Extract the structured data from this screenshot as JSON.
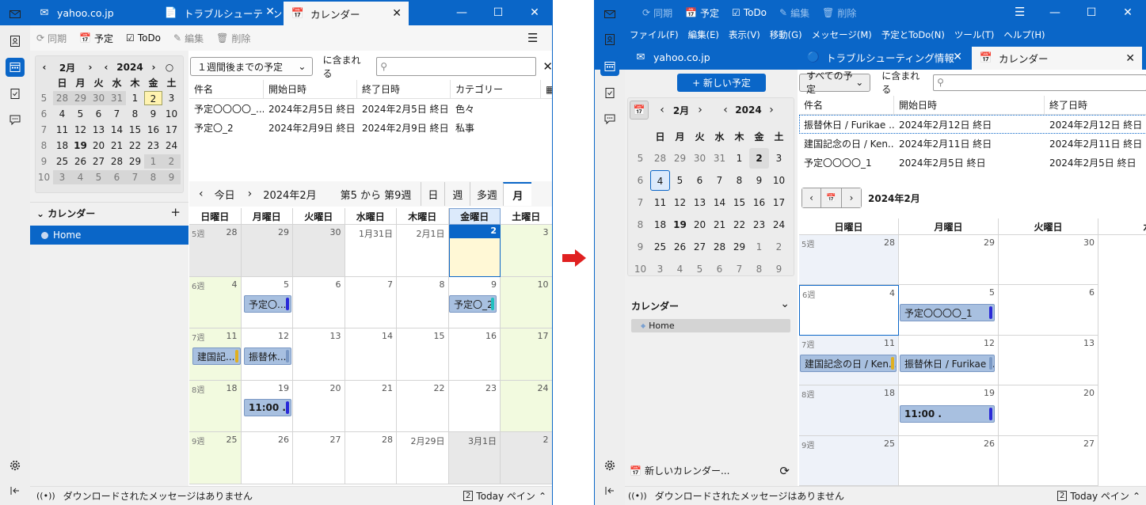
{
  "left": {
    "tabs": [
      {
        "icon": "mail-icon",
        "label": "yahoo.co.jp"
      },
      {
        "icon": "article-icon",
        "label": "トラブルシューティング"
      },
      {
        "icon": "calendar-icon",
        "label": "カレンダー"
      }
    ],
    "toolbar": {
      "sync": "同期",
      "event": "予定",
      "todo": "ToDo",
      "edit": "編集",
      "delete": "削除"
    },
    "minimonth": {
      "month": "2月",
      "year": "2024",
      "weekdays": [
        "日",
        "月",
        "火",
        "水",
        "木",
        "金",
        "土"
      ],
      "weeks": [
        {
          "wk": "5",
          "days": [
            "28",
            "29",
            "30",
            "31",
            "1",
            "2",
            "3"
          ]
        },
        {
          "wk": "6",
          "days": [
            "4",
            "5",
            "6",
            "7",
            "8",
            "9",
            "10"
          ]
        },
        {
          "wk": "7",
          "days": [
            "11",
            "12",
            "13",
            "14",
            "15",
            "16",
            "17"
          ]
        },
        {
          "wk": "8",
          "days": [
            "18",
            "19",
            "20",
            "21",
            "22",
            "23",
            "24"
          ]
        },
        {
          "wk": "9",
          "days": [
            "25",
            "26",
            "27",
            "28",
            "29",
            "1",
            "2"
          ]
        },
        {
          "wk": "10",
          "days": [
            "3",
            "4",
            "5",
            "6",
            "7",
            "8",
            "9"
          ]
        }
      ]
    },
    "calendars": {
      "title": "カレンダー",
      "add": "+",
      "items": [
        "Home"
      ]
    },
    "filter": {
      "range": "１週間後までの予定",
      "contains": "に含まれる",
      "search_placeholder": ""
    },
    "unifinder": {
      "headers": [
        "件名",
        "開始日時",
        "終了日時",
        "カテゴリー"
      ],
      "rows": [
        [
          "予定〇〇〇〇_...",
          "2024年2月5日 終日",
          "2024年2月5日 終日",
          "色々"
        ],
        [
          "予定〇_2",
          "2024年2月9日 終日",
          "2024年2月9日 終日",
          "私事"
        ]
      ]
    },
    "nav": {
      "today": "今日",
      "title": "2024年2月",
      "weeks": "第5 から 第9週",
      "views": [
        "日",
        "週",
        "多週",
        "月"
      ]
    },
    "weekdays": [
      "日曜日",
      "月曜日",
      "火曜日",
      "水曜日",
      "木曜日",
      "金曜日",
      "土曜日"
    ],
    "rows": [
      {
        "wk": "5週",
        "days": [
          "28",
          "29",
          "30",
          "1月31日",
          "2月1日",
          "2",
          "3"
        ]
      },
      {
        "wk": "6週",
        "days": [
          "4",
          "5",
          "6",
          "7",
          "8",
          "9",
          "10"
        ]
      },
      {
        "wk": "7週",
        "days": [
          "11",
          "12",
          "13",
          "14",
          "15",
          "16",
          "17"
        ]
      },
      {
        "wk": "8週",
        "days": [
          "18",
          "19",
          "20",
          "21",
          "22",
          "23",
          "24"
        ]
      },
      {
        "wk": "9週",
        "days": [
          "25",
          "26",
          "27",
          "28",
          "2月29日",
          "3月1日",
          "2"
        ]
      }
    ],
    "events": {
      "e1": "予定〇...",
      "e2": "予定〇_2",
      "e3": "建国記...",
      "e4": "振替休...",
      "e5": "11:00 ."
    },
    "status": {
      "text": "ダウンロードされたメッセージはありません",
      "today_pane": "Today ペイン",
      "today_num": "2"
    }
  },
  "right": {
    "toolbar": {
      "sync": "同期",
      "event": "予定",
      "todo": "ToDo",
      "edit": "編集",
      "delete": "削除"
    },
    "menu": [
      "ファイル(F)",
      "編集(E)",
      "表示(V)",
      "移動(G)",
      "メッセージ(M)",
      "予定とToDo(N)",
      "ツール(T)",
      "ヘルプ(H)"
    ],
    "tabs": [
      {
        "icon": "mail-icon",
        "label": "yahoo.co.jp"
      },
      {
        "icon": "article-icon",
        "label": "トラブルシューティング情報"
      },
      {
        "icon": "calendar-icon",
        "label": "カレンダー"
      }
    ],
    "new_event": "+ 新しい予定",
    "minimonth": {
      "month": "2月",
      "year": "2024",
      "weekdays": [
        "日",
        "月",
        "火",
        "水",
        "木",
        "金",
        "土"
      ],
      "weeks": [
        {
          "wk": "5",
          "days": [
            "28",
            "29",
            "30",
            "31",
            "1",
            "2",
            "3"
          ]
        },
        {
          "wk": "6",
          "days": [
            "4",
            "5",
            "6",
            "7",
            "8",
            "9",
            "10"
          ]
        },
        {
          "wk": "7",
          "days": [
            "11",
            "12",
            "13",
            "14",
            "15",
            "16",
            "17"
          ]
        },
        {
          "wk": "8",
          "days": [
            "18",
            "19",
            "20",
            "21",
            "22",
            "23",
            "24"
          ]
        },
        {
          "wk": "9",
          "days": [
            "25",
            "26",
            "27",
            "28",
            "29",
            "1",
            "2"
          ]
        },
        {
          "wk": "10",
          "days": [
            "3",
            "4",
            "5",
            "6",
            "7",
            "8",
            "9"
          ]
        }
      ]
    },
    "calendars": {
      "title": "カレンダー",
      "items": [
        "Home"
      ],
      "new_calendar": "新しいカレンダー..."
    },
    "filter": {
      "range": "すべての予定",
      "contains": "に含まれる"
    },
    "unifinder": {
      "headers": [
        "件名",
        "開始日時",
        "終了日時"
      ],
      "rows": [
        [
          "振替休日 / Furikae ...",
          "2024年2月12日 終日",
          "2024年2月12日 終日"
        ],
        [
          "建国記念の日 / Ken...",
          "2024年2月11日 終日",
          "2024年2月11日 終日"
        ],
        [
          "予定〇〇〇〇_1",
          "2024年2月5日 終日",
          "2024年2月5日 終日"
        ]
      ]
    },
    "nav": {
      "title": "2024年2月"
    },
    "weekdays": [
      "日曜日",
      "月曜日",
      "火曜日",
      "水"
    ],
    "rows": [
      {
        "wk": "5週",
        "days": [
          "28",
          "29",
          "30"
        ]
      },
      {
        "wk": "6週",
        "days": [
          "4",
          "5",
          "6"
        ]
      },
      {
        "wk": "7週",
        "days": [
          "11",
          "12",
          "13"
        ]
      },
      {
        "wk": "8週",
        "days": [
          "18",
          "19",
          "20"
        ]
      },
      {
        "wk": "9週",
        "days": [
          "25",
          "26",
          "27"
        ]
      }
    ],
    "events": {
      "e1": "予定〇〇〇〇_1",
      "e2": "建国記念の日 / Ken...",
      "e3": "振替休日 / Furikae ...",
      "e4": "11:00 ."
    },
    "status": {
      "text": "ダウンロードされたメッセージはありません",
      "today_pane": "Today ペイン",
      "today_num": "2"
    }
  },
  "colors": {
    "accent": "#0a66c8",
    "event": "#a8c0e0",
    "weekend": "#f2fadf",
    "today": "#fff8d6",
    "arrow": "#e02020"
  }
}
